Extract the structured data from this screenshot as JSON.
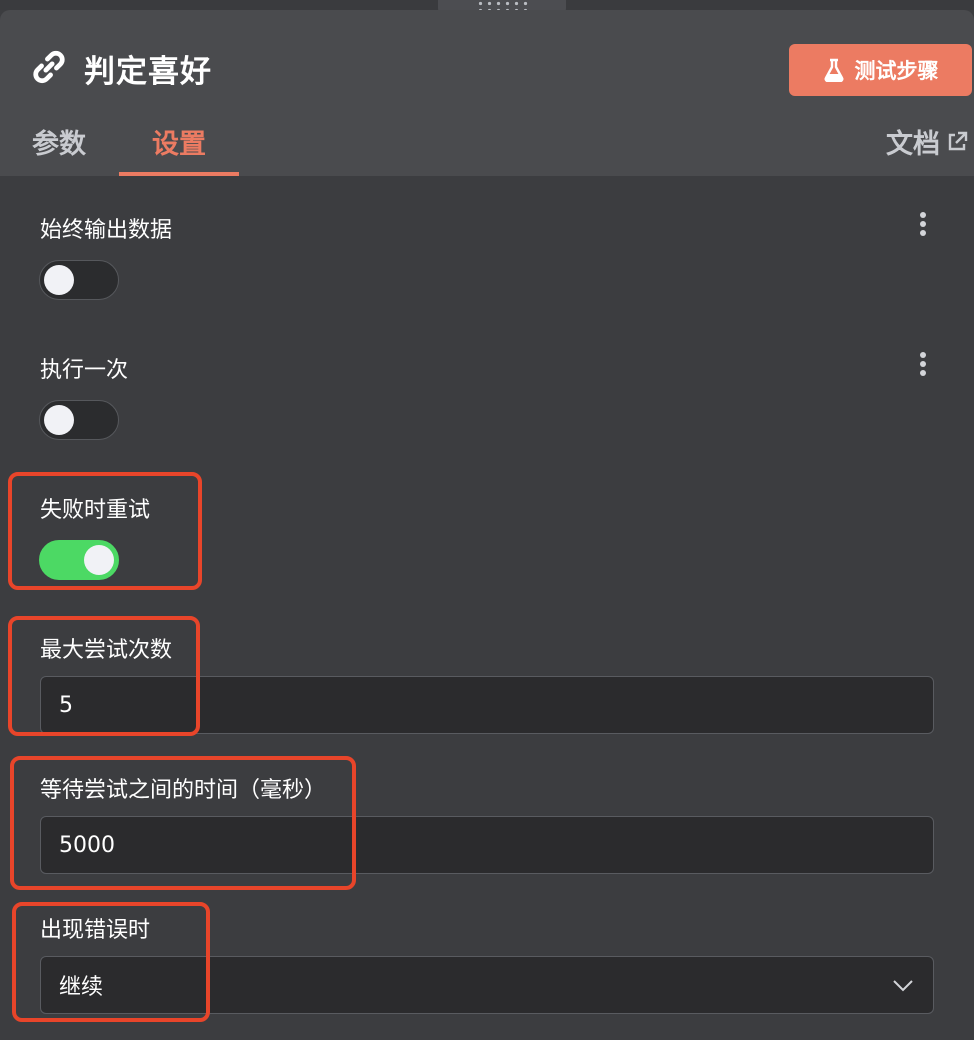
{
  "header": {
    "title": "判定喜好",
    "test_button": "测试步骤"
  },
  "tabs": {
    "params": "参数",
    "settings": "设置",
    "docs": "文档"
  },
  "settings": {
    "always_output": {
      "label": "始终输出数据",
      "enabled": false
    },
    "execute_once": {
      "label": "执行一次",
      "enabled": false
    },
    "retry_on_fail": {
      "label": "失败时重试",
      "enabled": true
    },
    "max_tries": {
      "label": "最大尝试次数",
      "value": "5"
    },
    "wait_between": {
      "label": "等待尝试之间的时间（毫秒）",
      "value": "5000"
    },
    "on_error": {
      "label": "出现错误时",
      "value": "继续"
    }
  },
  "colors": {
    "accent": "#ec7b62",
    "toggle_on": "#4cd964",
    "highlight": "#e8452a"
  }
}
